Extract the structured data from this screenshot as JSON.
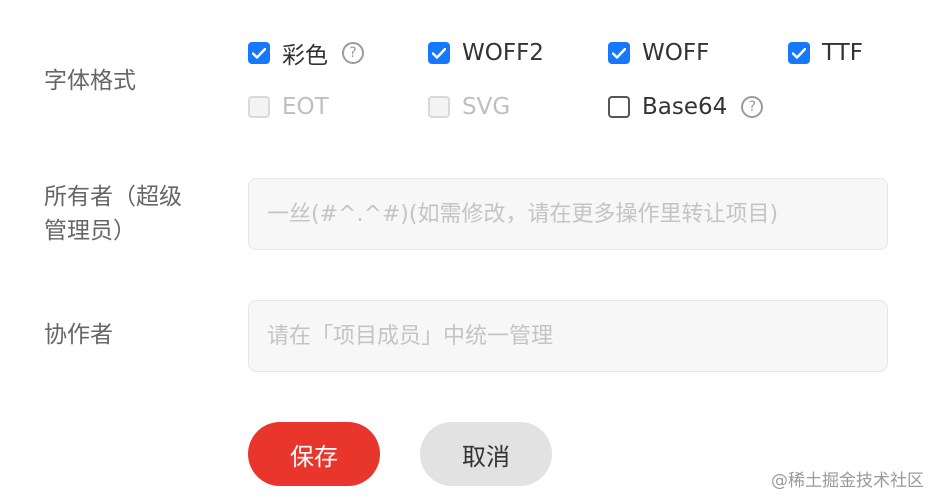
{
  "font_format": {
    "label": "字体格式",
    "options": [
      {
        "label": "彩色",
        "checked": true,
        "disabled": false,
        "help": true
      },
      {
        "label": "WOFF2",
        "checked": true,
        "disabled": false,
        "help": false
      },
      {
        "label": "WOFF",
        "checked": true,
        "disabled": false,
        "help": false
      },
      {
        "label": "TTF",
        "checked": true,
        "disabled": false,
        "help": false
      },
      {
        "label": "EOT",
        "checked": false,
        "disabled": true,
        "help": false
      },
      {
        "label": "SVG",
        "checked": false,
        "disabled": true,
        "help": false
      },
      {
        "label": "Base64",
        "checked": false,
        "disabled": false,
        "help": true
      }
    ],
    "help_glyph": "?"
  },
  "owner": {
    "label": "所有者（超级管理员）",
    "placeholder": "一丝(#^.^#)(如需修改，请在更多操作里转让项目)"
  },
  "collaborators": {
    "label": "协作者",
    "placeholder": "请在「项目成员」中统一管理"
  },
  "actions": {
    "save_label": "保存",
    "cancel_label": "取消"
  },
  "watermark": "@稀土掘金技术社区",
  "colors": {
    "checkbox_checked": "#1677ff",
    "save_button": "#e8362d",
    "cancel_button": "#e2e2e2"
  }
}
